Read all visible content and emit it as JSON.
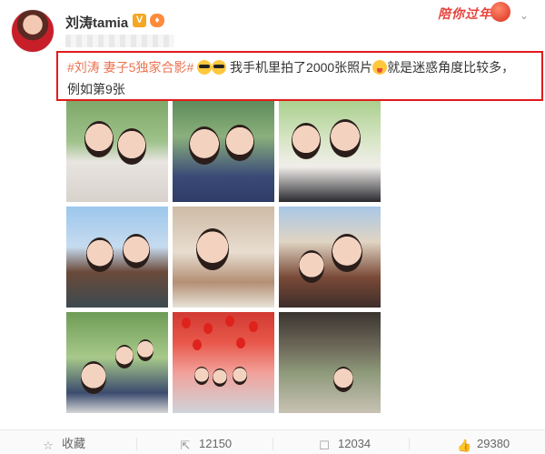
{
  "author": {
    "name": "刘涛tamia",
    "verified_badge": "V",
    "level_badge": "♦"
  },
  "promo": {
    "text": "陪你过年"
  },
  "post": {
    "hashtag": "#刘涛 妻子5独家合影#",
    "text_part1": "我手机里拍了2000张照片",
    "text_part2": "就是迷惑角度比较多，",
    "text_part3": "例如第9张"
  },
  "photos": [
    {
      "name": "photo-1"
    },
    {
      "name": "photo-2"
    },
    {
      "name": "photo-3"
    },
    {
      "name": "photo-4"
    },
    {
      "name": "photo-5"
    },
    {
      "name": "photo-6"
    },
    {
      "name": "photo-7"
    },
    {
      "name": "photo-8"
    },
    {
      "name": "photo-9"
    }
  ],
  "actions": {
    "favorite_label": "收藏",
    "repost_count": "12150",
    "comment_count": "12034",
    "like_count": "29380"
  },
  "colors": {
    "hashtag": "#eb7350",
    "highlight_border": "#e21b1b",
    "promo": "#e8423b"
  },
  "icons": [
    "star-icon",
    "repost-icon",
    "comment-icon",
    "like-icon",
    "chevron-down-icon",
    "verified-icon"
  ]
}
